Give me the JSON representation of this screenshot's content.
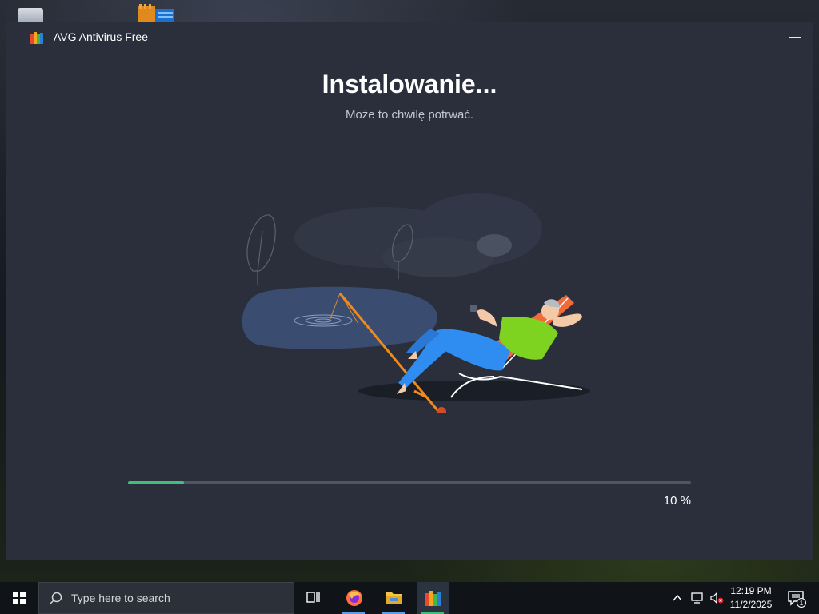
{
  "window": {
    "title": "AVG Antivirus Free",
    "heading": "Instalowanie...",
    "subheading": "Może to chwilę potrwać.",
    "minimize_icon": "minimize-icon",
    "logo_icon": "avg-logo-icon"
  },
  "progress": {
    "value": 0.1,
    "label": "10 %",
    "fill_color": "#3ec07a",
    "track_color": "#4e5563"
  },
  "taskbar": {
    "search_placeholder": "Type here to search",
    "apps": [
      {
        "name": "task-view",
        "icon": "task-view-icon"
      },
      {
        "name": "firefox",
        "icon": "firefox-icon"
      },
      {
        "name": "file-explorer",
        "icon": "folder-icon"
      },
      {
        "name": "avg-installer",
        "icon": "avg-logo-icon"
      }
    ],
    "clock": {
      "time": "12:19 PM",
      "date": "11/2/2025"
    },
    "notification_count": "1"
  },
  "colors": {
    "window_bg": "#2a2f3b",
    "accent_green": "#3ec07a",
    "taskbar_bg": "#101318"
  }
}
